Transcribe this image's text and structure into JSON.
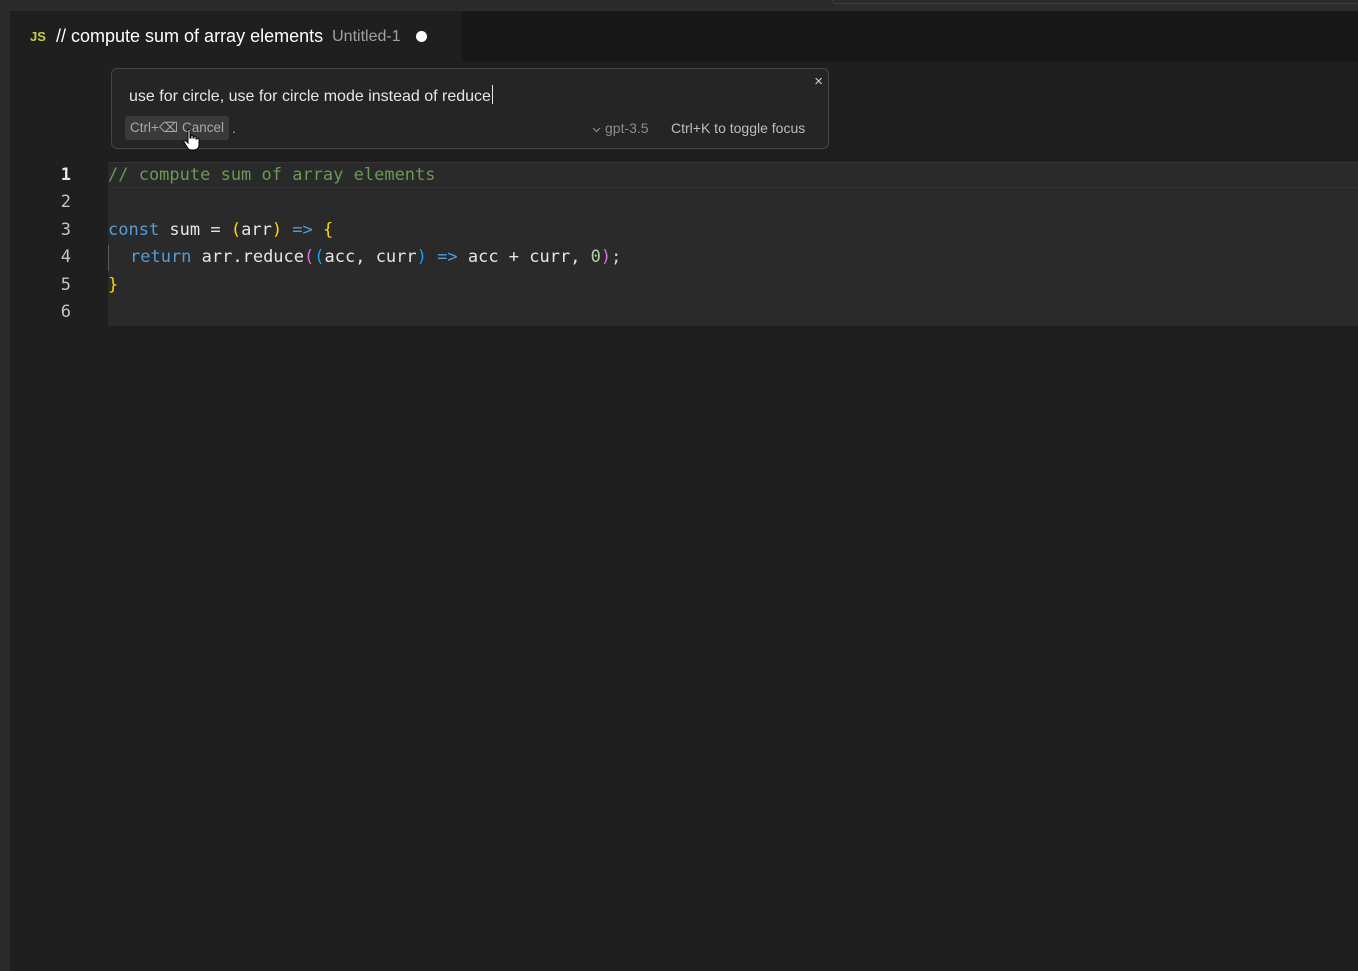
{
  "tab": {
    "lang_badge": "JS",
    "title": "// compute sum of array elements",
    "description": "Untitled-1"
  },
  "prompt": {
    "value": "use for circle, use for circle mode instead of reduce",
    "cancel_shortcut": "Ctrl+⌫",
    "cancel_label": "Cancel",
    "trailing": ".",
    "close_label": "×",
    "model": "gpt-3.5",
    "toggle_hint": "Ctrl+K to toggle focus"
  },
  "line_numbers": [
    "1",
    "2",
    "3",
    "4",
    "5",
    "6"
  ],
  "code": {
    "line1": {
      "comment": "// compute sum of array elements"
    },
    "line3": {
      "kw": "const",
      "name": " sum = ",
      "open_paren": "(",
      "param": "arr",
      "close_paren": ")",
      "arrow": " => ",
      "brace": "{"
    },
    "line4": {
      "kw": "return",
      "call": " arr.reduce",
      "p1": "(",
      "p2": "(",
      "args": "acc, curr",
      "p3": ")",
      "arrow": " => ",
      "expr": "acc + curr, ",
      "num": "0",
      "p4": ")",
      "semi": ";"
    },
    "line5": {
      "brace": "}"
    }
  },
  "colors": {
    "background": "#1f1f1f",
    "comment": "#6a9955",
    "keyword": "#569cd6",
    "bracket_gold": "#ffd700",
    "bracket_purple": "#da70d6",
    "bracket_blue": "#179fff"
  }
}
